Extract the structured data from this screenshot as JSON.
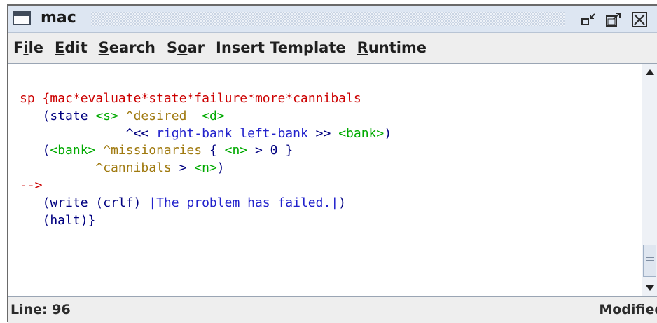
{
  "window": {
    "title": "mac"
  },
  "menu": {
    "items": [
      {
        "pre": "F",
        "key": "i",
        "post": "le"
      },
      {
        "pre": "",
        "key": "E",
        "post": "dit"
      },
      {
        "pre": "",
        "key": "S",
        "post": "earch"
      },
      {
        "pre": "S",
        "key": "o",
        "post": "ar"
      },
      {
        "pre": "Insert Template",
        "key": "",
        "post": ""
      },
      {
        "pre": "",
        "key": "R",
        "post": "untime"
      }
    ]
  },
  "editor": {
    "code": {
      "l1_sp": "sp",
      "l1_brace": "{",
      "l1_name": "mac*evaluate*state*failure*more*cannibals",
      "l2_a": "   (state ",
      "l2_var": "<s>",
      "l2_attr": " ^desired ",
      "l2_var2": "<d>",
      "l3_a": "              ^<< ",
      "l3_txt": "right-bank left-bank",
      "l3_b": " >> ",
      "l3_var": "<bank>",
      "l3_c": ")",
      "l4_a": "   (",
      "l4_var": "<bank>",
      "l4_attr": " ^missionaries",
      "l4_b": " { ",
      "l4_var2": "<n>",
      "l4_c": " > 0 }",
      "l5_a": "          ",
      "l5_attr": "^cannibals",
      "l5_b": " > ",
      "l5_var": "<n>",
      "l5_c": ")",
      "l6_arrow": "-->",
      "l7_a": "   (write (crlf) ",
      "l7_txt": "|The problem has failed.|",
      "l7_b": ")",
      "l8_a": "   (halt)}"
    }
  },
  "status": {
    "line": "Line: 96",
    "modified": "Modified"
  },
  "icons": {
    "frame": "window-frame-icon",
    "minimize": "minimize-icon",
    "maximize": "maximize-icon",
    "close": "close-icon",
    "scroll_up": "arrow-up-icon",
    "scroll_down": "arrow-down-icon"
  },
  "colors": {
    "keyword_red": "#cc0000",
    "variable_green": "#00aa00",
    "attribute_gold": "#a07a10",
    "text_blue": "#2222cc",
    "default_navy": "#000080"
  }
}
